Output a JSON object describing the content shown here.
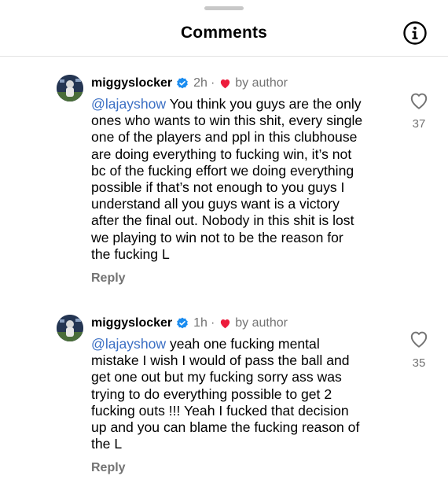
{
  "header": {
    "title": "Comments",
    "info_icon": "info-circle-icon"
  },
  "comments": [
    {
      "username": "miggyslocker",
      "time": "2h",
      "separator": "·",
      "author_badge": "by author",
      "lines": [
        {
          "mention": "@lajayshow",
          "text": " You think you guys are the only"
        },
        {
          "mention": "",
          "text": "ones who wants to win this shit, every single"
        },
        {
          "mention": "",
          "text": "one of the players and ppl in this clubhouse"
        },
        {
          "mention": "",
          "text": "are doing everything to fucking win, it’s not"
        },
        {
          "mention": "",
          "text": "bc of the fucking effort we doing everything"
        },
        {
          "mention": "",
          "text": "possible if that’s not enough to you guys I"
        },
        {
          "mention": "",
          "text": "understand all you guys want is a victory"
        },
        {
          "mention": "",
          "text": "after the final out. Nobody in this shit is lost"
        },
        {
          "mention": "",
          "text": "we playing to win not to be the reason for"
        },
        {
          "mention": "",
          "text": "the fucking L"
        }
      ],
      "reply_label": "Reply",
      "like_count": "37"
    },
    {
      "username": "miggyslocker",
      "time": "1h",
      "separator": "·",
      "author_badge": "by author",
      "lines": [
        {
          "mention": "@lajayshow",
          "text": " yeah one fucking mental"
        },
        {
          "mention": "",
          "text": "mistake I wish I would of pass the ball and"
        },
        {
          "mention": "",
          "text": "get one out but my fucking sorry ass was"
        },
        {
          "mention": "",
          "text": "trying to do everything possible to get 2"
        },
        {
          "mention": "",
          "text": "fucking outs !!! Yeah I fucked that decision"
        },
        {
          "mention": "",
          "text": "up and you can blame the fucking reason of"
        },
        {
          "mention": "",
          "text": "the L"
        }
      ],
      "reply_label": "Reply",
      "like_count": "35"
    }
  ],
  "colors": {
    "mention": "#3b6fc4",
    "heart": "#ed1c3c",
    "verified": "#1a8cf0",
    "secondary_text": "#737373"
  }
}
